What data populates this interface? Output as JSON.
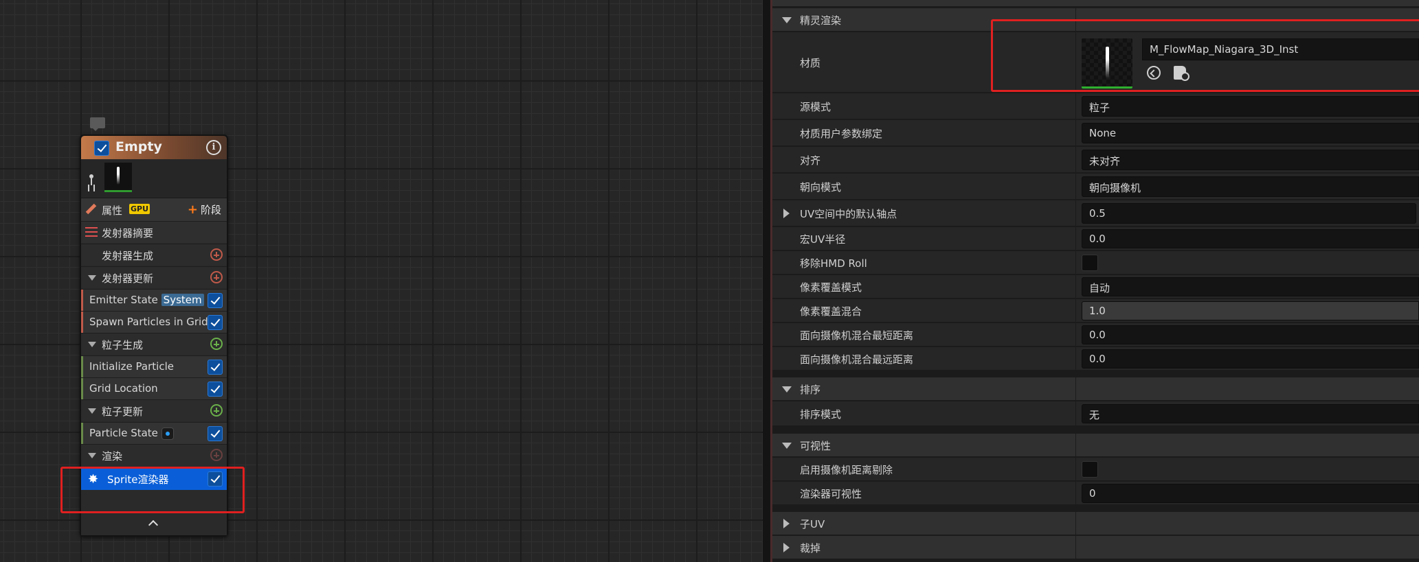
{
  "node": {
    "title": "Empty",
    "properties_label": "属性",
    "gpu_badge": "GPU",
    "stage_label": "阶段",
    "items": [
      {
        "label": "发射器摘要"
      },
      {
        "label": "发射器生成"
      },
      {
        "label": "发射器更新"
      },
      {
        "label": "Emitter State",
        "tag": "System"
      },
      {
        "label": "Spawn Particles in Grid"
      },
      {
        "label": "粒子生成"
      },
      {
        "label": "Initialize Particle"
      },
      {
        "label": "Grid Location"
      },
      {
        "label": "粒子更新"
      },
      {
        "label": "Particle State"
      },
      {
        "label": "渲染"
      },
      {
        "label": "Sprite渲染器"
      }
    ]
  },
  "details": {
    "sections": {
      "sprite_render": "精灵渲染",
      "sort": "排序",
      "visibility": "可视性",
      "sub_uv": "子UV",
      "cull": "裁掉"
    },
    "material": {
      "label": "材质",
      "value": "M_FlowMap_Niagara_3D_Inst"
    },
    "rows": [
      {
        "label": "源模式",
        "value": "粒子"
      },
      {
        "label": "材质用户参数绑定",
        "value": "None"
      },
      {
        "label": "对齐",
        "value": "未对齐"
      },
      {
        "label": "朝向模式",
        "value": "朝向摄像机"
      },
      {
        "label": "UV空间中的默认轴点",
        "value": "0.5"
      },
      {
        "label": "宏UV半径",
        "value": "0.0"
      },
      {
        "label": "移除HMD Roll",
        "value": ""
      },
      {
        "label": "像素覆盖模式",
        "value": "自动"
      },
      {
        "label": "像素覆盖混合",
        "value": "1.0"
      },
      {
        "label": "面向摄像机混合最短距离",
        "value": "0.0"
      },
      {
        "label": "面向摄像机混合最远距离",
        "value": "0.0"
      }
    ],
    "sort_rows": [
      {
        "label": "排序模式",
        "value": "无"
      }
    ],
    "visibility_rows": [
      {
        "label": "启用摄像机距离剔除",
        "value": ""
      },
      {
        "label": "渲染器可视性",
        "value": "0"
      }
    ]
  },
  "colors": {
    "node_header": "#c47a4a",
    "selected": "#0a5fd8",
    "highlight_box": "#e02020",
    "checkbox": "#0d4f9c"
  }
}
